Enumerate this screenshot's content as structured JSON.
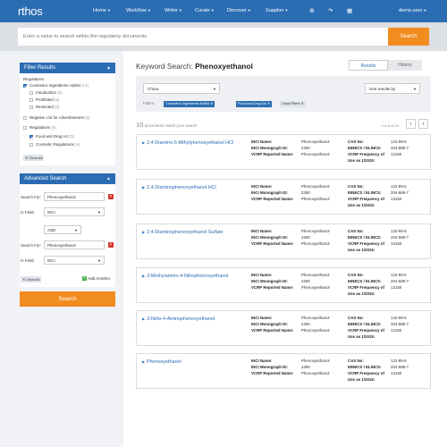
{
  "app": {
    "logo": "rthos"
  },
  "nav": {
    "items": [
      "Home",
      "Workflow",
      "Writer",
      "Curate",
      "Discover",
      "Supplier"
    ],
    "user": "demo.user"
  },
  "search": {
    "placeholder": "Enter a value to search within the regulatory documents",
    "button": "Search"
  },
  "filter_results": {
    "title": "Filter Results",
    "group1_label": "Regulations",
    "items1": [
      {
        "label": "Cosmetics Ingredients Hotlist",
        "count": "(13)",
        "checked": true
      },
      {
        "label": "Introduction",
        "count": "(6)",
        "checked": false
      },
      {
        "label": "Prohibited",
        "count": "(6)",
        "checked": false
      },
      {
        "label": "Restricted",
        "count": "(2)",
        "checked": false
      }
    ],
    "negative_list": {
      "label": "Negative List for Advertisement",
      "count": "(8)"
    },
    "group2": {
      "label": "Regulations",
      "count": "(9)"
    },
    "items2": [
      {
        "label": "Food and Drug Act",
        "count": "(5)",
        "checked": true
      },
      {
        "label": "Cosmetic Regulations",
        "count": "(4)",
        "checked": false
      }
    ],
    "clear_all": "Clear All"
  },
  "advanced_search": {
    "title": "Advanced Search",
    "search_for_label": "Search For:",
    "in_field_label": "In Field:",
    "value1": "Phenoxyethanol",
    "field1": "INCI",
    "operator": "AND",
    "value2": "Phenoxyethanol",
    "field2": "INCI",
    "clear_all": "Clear All",
    "add_another": "Add Another",
    "search_button": "Search"
  },
  "main": {
    "title_prefix": "Keyword Search:",
    "title_term": "Phenoxyethanol",
    "tabs": [
      "Results",
      "History"
    ],
    "country": "China",
    "sort": "Sort results by",
    "filters_label": "Filters:",
    "filter_chips": [
      "Cosmetics Ingredients Hotlist",
      "Food and Drug Act",
      "Clear Filters"
    ],
    "count_number": "10",
    "count_text": "documents match your search",
    "pager_text": "1 to 6 of 10",
    "prev": "‹",
    "next": "›"
  },
  "field_labels": {
    "inci_name": "INCI Name:",
    "inci_monograph": "INCI Monograph ID:",
    "vcrp_reported": "VCRP Reported Name:",
    "cas": "CAS No:",
    "einecs": "EINECS / ELINCS:",
    "vcrp_freq": "VCRP Frequency of",
    "use_as": "Use as 1/2015:"
  },
  "results": [
    {
      "name": "2,4-Diamino-5-Mthylphenoxyethanol HCl",
      "inci": "Phenoxyethanol",
      "monograph": "2290",
      "vcrp": "Phenoxyethanol",
      "cas": "122-99-6",
      "einecs": "204-589-7",
      "freq": "13150"
    },
    {
      "name": "2,4-Diaminophenoxyethanol HCl",
      "inci": "Phenoxyethanol",
      "monograph": "2290",
      "vcrp": "Phenoxyethanol",
      "cas": "122-99-6",
      "einecs": "204-589-7",
      "freq": "13150"
    },
    {
      "name": "2,4-Diaminophenoxyethanol Sulfate",
      "inci": "Phenoxyethanol",
      "monograph": "2290",
      "vcrp": "Phenoxyethanol",
      "cas": "122-99-6",
      "einecs": "204-589-7",
      "freq": "13150"
    },
    {
      "name": "3-Methylamino-4-Nitrophenoxyethanol",
      "inci": "Phenoxyethanol",
      "monograph": "2290",
      "vcrp": "Phenoxyethanol",
      "cas": "122-99-6",
      "einecs": "204-589-7",
      "freq": "13150"
    },
    {
      "name": "3-Nirto-4-Aminophenoxyethanol",
      "inci": "Phenoxyethanol",
      "monograph": "2290",
      "vcrp": "Phenoxyethanol",
      "cas": "122-99-6",
      "einecs": "204-589-7",
      "freq": "13150"
    },
    {
      "name": "Phenoxyethanol",
      "inci": "Phenoxyethanol",
      "monograph": "2290",
      "vcrp": "Phenoxyethanol",
      "cas": "122-99-6",
      "einecs": "204-589-7",
      "freq": "13150"
    }
  ],
  "colors": {
    "brand": "#2b6db3",
    "accent": "#f18c21",
    "danger": "#d9372f",
    "add": "#4caf50"
  }
}
